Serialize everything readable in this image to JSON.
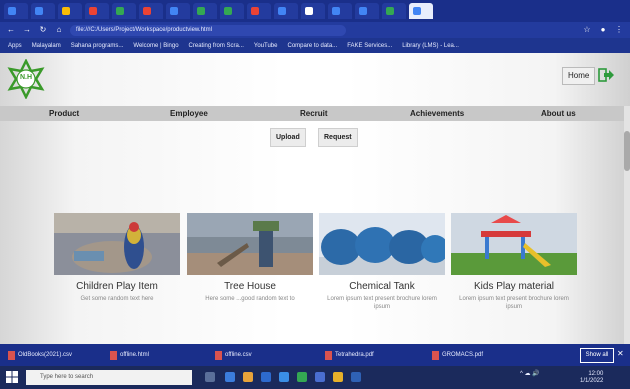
{
  "browser": {
    "url": "file:///C:/Users/Project/Workspace/productview.html",
    "tabs": [
      {
        "color": "#4285f4"
      },
      {
        "color": "#4285f4"
      },
      {
        "color": "#fbbc05"
      },
      {
        "color": "#ea4335"
      },
      {
        "color": "#34a853"
      },
      {
        "color": "#ea4335"
      },
      {
        "color": "#4285f4"
      },
      {
        "color": "#34a853"
      },
      {
        "color": "#34a853"
      },
      {
        "color": "#ea4335"
      },
      {
        "color": "#4285f4"
      },
      {
        "color": "#ffffff"
      },
      {
        "color": "#4285f4"
      },
      {
        "color": "#4285f4"
      },
      {
        "color": "#34a853"
      },
      {
        "color": "#4285f4",
        "active": true
      }
    ],
    "bookmarks": [
      "Apps",
      "Malayalam",
      "Sahana programs...",
      "Welcome | Bingo",
      "Creating from Scra...",
      "YouTube",
      "Compare to data...",
      "FAKE Services...",
      "Library (LMS) - Lea..."
    ]
  },
  "header": {
    "logo_text": "N.H",
    "home_label": "Home",
    "exit_icon": "logout-icon"
  },
  "nav": {
    "items": [
      "Product",
      "Employee",
      "Recruit",
      "Achievements",
      "About us"
    ]
  },
  "subnav": {
    "upload_label": "Upload",
    "request_label": "Request"
  },
  "cards": [
    {
      "title": "Children Play Item",
      "desc": "Get some random text here"
    },
    {
      "title": "Tree House",
      "desc": "Here some ...good random text to"
    },
    {
      "title": "Chemical Tank",
      "desc": "Lorem ipsum text present brochure lorem ipsum"
    },
    {
      "title": "Kids Play material",
      "desc": "Lorem ipsum text present brochure lorem ipsum"
    }
  ],
  "downloads": {
    "items": [
      "OldBooks(2021).csv",
      "offline.html",
      "offline.csv",
      "Tetrahedra.pdf",
      "GROMACS.pdf"
    ],
    "show_all_label": "Show all"
  },
  "taskbar": {
    "search_placeholder": "Type here to search",
    "time": "12:00",
    "date": "1/1/2022"
  }
}
